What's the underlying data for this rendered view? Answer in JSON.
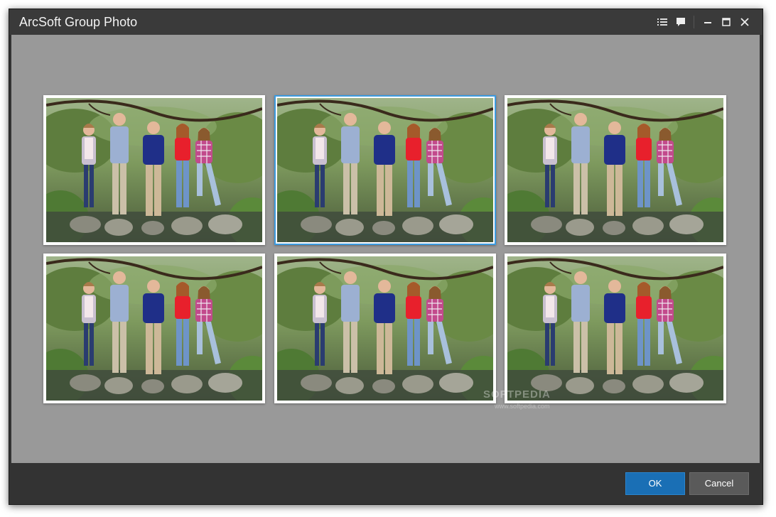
{
  "window": {
    "title": "ArcSoft Group Photo"
  },
  "titlebar_buttons": [
    {
      "name": "list-view-icon"
    },
    {
      "name": "feedback-icon"
    },
    {
      "name": "minimize-icon"
    },
    {
      "name": "maximize-icon"
    },
    {
      "name": "close-icon"
    }
  ],
  "photos": {
    "selected_index": 1,
    "count": 6
  },
  "footer": {
    "ok_label": "OK",
    "cancel_label": "Cancel"
  },
  "watermark": {
    "text": "SOFTPEDIA",
    "url": "www.softpedia.com"
  },
  "colors": {
    "accent": "#1a6fb5",
    "selection": "#3b9be0",
    "canvas": "#999999",
    "chrome": "#333333"
  }
}
